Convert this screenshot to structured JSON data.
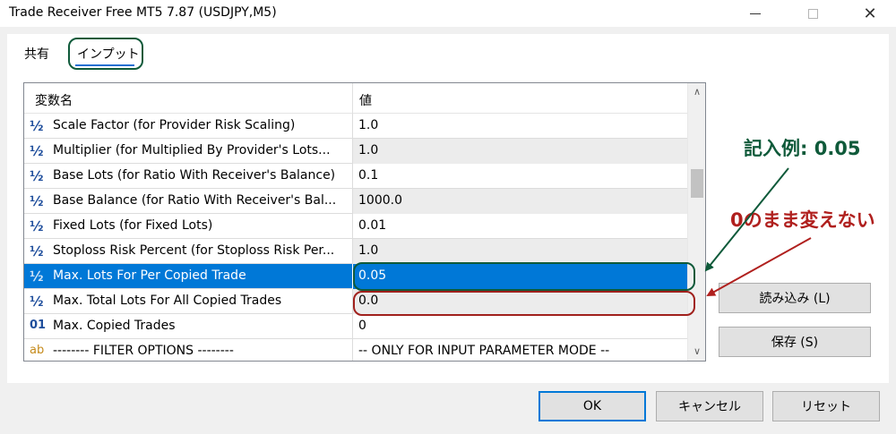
{
  "window": {
    "title": "Trade Receiver Free MT5 7.87 (USDJPY,M5)",
    "close_glyph": "✕"
  },
  "tabs": [
    {
      "label": "共有",
      "active": false
    },
    {
      "label": "インプット",
      "active": true
    }
  ],
  "table": {
    "columns": [
      "変数名",
      "値"
    ],
    "rows": [
      {
        "icon": "½",
        "icon_name": "fraction-icon",
        "name": "Scale Factor (for Provider Risk Scaling)",
        "value": "1.0"
      },
      {
        "icon": "½",
        "icon_name": "fraction-icon",
        "name": "Multiplier (for Multiplied By Provider's Lots...",
        "value": "1.0"
      },
      {
        "icon": "½",
        "icon_name": "fraction-icon",
        "name": "Base Lots (for Ratio With Receiver's Balance)",
        "value": "0.1"
      },
      {
        "icon": "½",
        "icon_name": "fraction-icon",
        "name": "Base Balance (for Ratio With Receiver's Bal...",
        "value": "1000.0"
      },
      {
        "icon": "½",
        "icon_name": "fraction-icon",
        "name": "Fixed Lots (for Fixed Lots)",
        "value": "0.01"
      },
      {
        "icon": "½",
        "icon_name": "fraction-icon",
        "name": "Stoploss Risk Percent (for Stoploss Risk Per...",
        "value": "1.0"
      },
      {
        "icon": "½",
        "icon_name": "fraction-icon",
        "name": "Max. Lots For Per Copied Trade",
        "value": "0.05",
        "selected": true
      },
      {
        "icon": "½",
        "icon_name": "fraction-icon",
        "name": "Max. Total Lots For All Copied Trades",
        "value": "0.0"
      },
      {
        "icon": "01",
        "icon_name": "integer-icon",
        "name": "Max. Copied Trades",
        "value": "0"
      },
      {
        "icon": "ab",
        "icon_name": "string-icon",
        "name": "-------- FILTER OPTIONS --------",
        "value": "-- ONLY FOR INPUT PARAMETER MODE --"
      }
    ],
    "scrollbar": {
      "up_glyph": "∧",
      "down_glyph": "∨",
      "thumb_position": 0.32
    }
  },
  "buttons": {
    "load": "読み込み (L)",
    "save": "保存 (S)",
    "ok": "OK",
    "cancel": "キャンセル",
    "reset": "リセット"
  },
  "annotations": {
    "example": "記入例: 0.05",
    "keep_zero": "0のまま変えない",
    "green": "#0f5a3a",
    "red": "#b0201e"
  }
}
